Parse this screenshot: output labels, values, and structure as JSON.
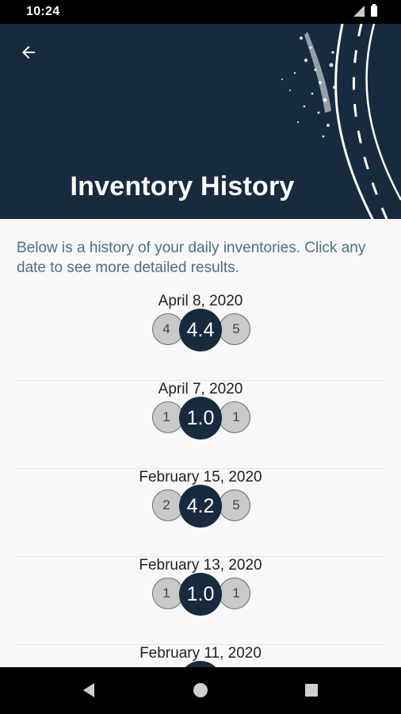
{
  "status_bar": {
    "time": "10:24"
  },
  "header": {
    "title": "Inventory History"
  },
  "intro_text": "Below is a history of your daily inventories. Click any date to see more detailed results.",
  "history": [
    {
      "date": "April 8, 2020",
      "left": "4",
      "score": "4.4",
      "right": "5"
    },
    {
      "date": "April 7, 2020",
      "left": "1",
      "score": "1.0",
      "right": "1"
    },
    {
      "date": "February 15, 2020",
      "left": "2",
      "score": "4.2",
      "right": "5"
    },
    {
      "date": "February 13, 2020",
      "left": "1",
      "score": "1.0",
      "right": "1"
    },
    {
      "date": "February 11, 2020"
    }
  ],
  "colors": {
    "header_bg": "#182a3e",
    "accent_text": "#4e6f83",
    "score_bg": "#182a3e"
  },
  "icons": {
    "back": "arrow-left-icon",
    "nav_back": "triangle-back-icon",
    "nav_home": "circle-home-icon",
    "nav_recent": "square-recents-icon"
  }
}
